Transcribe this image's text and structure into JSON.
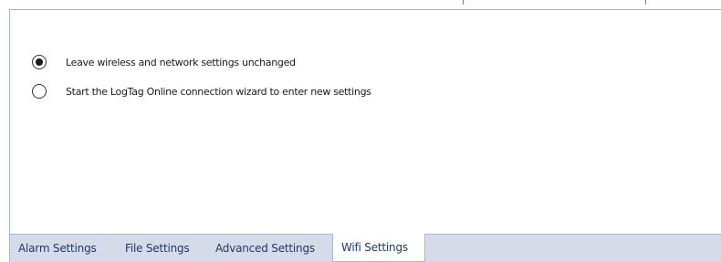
{
  "options": [
    {
      "label": "Leave wireless and network settings unchanged",
      "checked": true
    },
    {
      "label": "Start the LogTag Online connection wizard to enter new settings",
      "checked": false
    }
  ],
  "tabs": [
    {
      "label": "Alarm Settings",
      "active": false
    },
    {
      "label": "File Settings",
      "active": false
    },
    {
      "label": "Advanced Settings",
      "active": false
    },
    {
      "label": "Wifi Settings",
      "active": true
    }
  ]
}
